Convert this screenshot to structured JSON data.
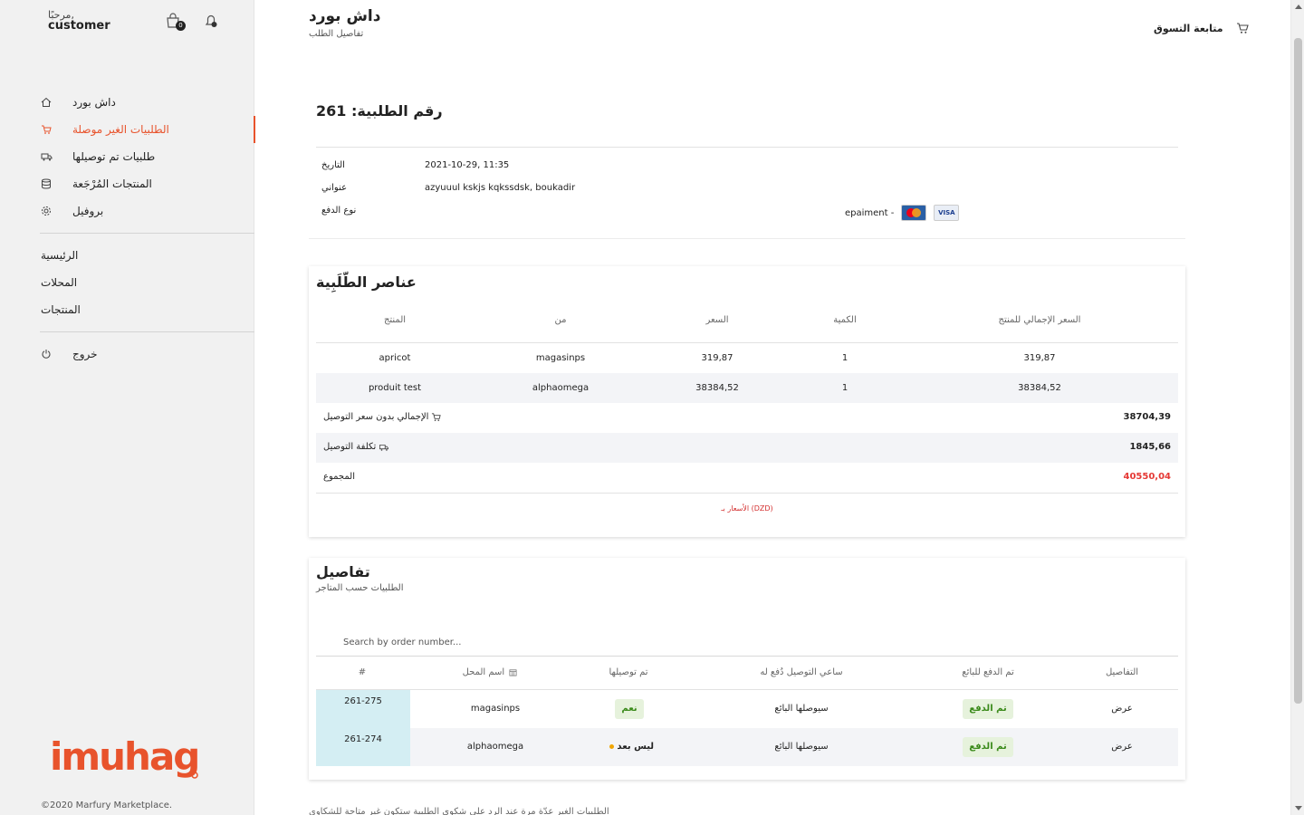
{
  "sidebar": {
    "greeting": "مرحبًا,",
    "username": "customer",
    "cart_count": "0",
    "menu": [
      {
        "label": "داش بورد"
      },
      {
        "label": "الطلبيات الغير موصلة"
      },
      {
        "label": "طلبيات تم توصيلها"
      },
      {
        "label": "المنتجات المُرْجَعة"
      },
      {
        "label": "بروفيل"
      }
    ],
    "links": [
      {
        "label": "الرئيسية"
      },
      {
        "label": "المحلات"
      },
      {
        "label": "المنتجات"
      }
    ],
    "logout": "خروج",
    "logo_text": "imuhag",
    "copyright": "©2020 Marfury Marketplace."
  },
  "header": {
    "title": "داش بورد",
    "subtitle": "تفاصيل الطلب",
    "continue_shopping": "متابعة التسوق"
  },
  "order": {
    "title": "رقم الطلبية: 261",
    "date_label": "التاريخ",
    "date_value": "2021-10-29, 11:35",
    "address_label": "عنواني",
    "address_value": "azyuuul kskjs kqkssdsk, boukadir",
    "payment_label": "نوع الدفع",
    "payment_value": "epaiment -",
    "card_icons": [
      "mastercard-icon",
      "visa-icon"
    ],
    "visa_text": "VISA"
  },
  "items": {
    "title": "عناصر الطّلَبِية",
    "headers": {
      "product": "المنتج",
      "from": "من",
      "price": "السعر",
      "qty": "الكمية",
      "total": "السعر الإجمالي للمنتج"
    },
    "rows": [
      {
        "product": "apricot",
        "from": "magasinps",
        "price": "319,87",
        "qty": "1",
        "total": "319,87"
      },
      {
        "product": "produit test",
        "from": "alphaomega",
        "price": "38384,52",
        "qty": "1",
        "total": "38384,52"
      }
    ],
    "subtotal_label": "الإجمالي بدون سعر التوصيل",
    "subtotal_value": "38704,39",
    "shipping_label": "تكلفة التوصيل",
    "shipping_value": "1845,66",
    "total_label": "المجموع",
    "total_value": "40550,04",
    "currency_note": "الأسعار بـ (DZD)"
  },
  "details": {
    "title": "تفاصيل",
    "subtitle": "الطلبيات حسب المتاجر",
    "search_placeholder": "Search by order number...",
    "headers": {
      "hash": "#",
      "store": "اسم المحل",
      "delivered": "تم توصيلها",
      "courier": "ساعي التوصيل دُفع له",
      "paid_seller": "تم الدفع للبائع",
      "details": "التفاصيل"
    },
    "rows": [
      {
        "hash": "261-275",
        "store": "magasinps",
        "delivered": "نعم",
        "courier": "سيوصلها البائع",
        "paid_seller": "تم الدفع",
        "details": "عرض"
      },
      {
        "hash": "261-274",
        "store": "alphaomega",
        "delivered": "ليس بعد",
        "courier": "سيوصلها البائع",
        "paid_seller": "تم الدفع",
        "details": "عرض"
      }
    ]
  },
  "footer_note": "الطلبيات الغير عدّة مرة عند الرد على شكوى الطلبية ستكون غير متاحة للشكاوي",
  "colors": {
    "accent": "#e8532c",
    "total_red": "#e53935",
    "paid_green": "#3a8a1a",
    "hash_cell": "#d4eef3"
  }
}
